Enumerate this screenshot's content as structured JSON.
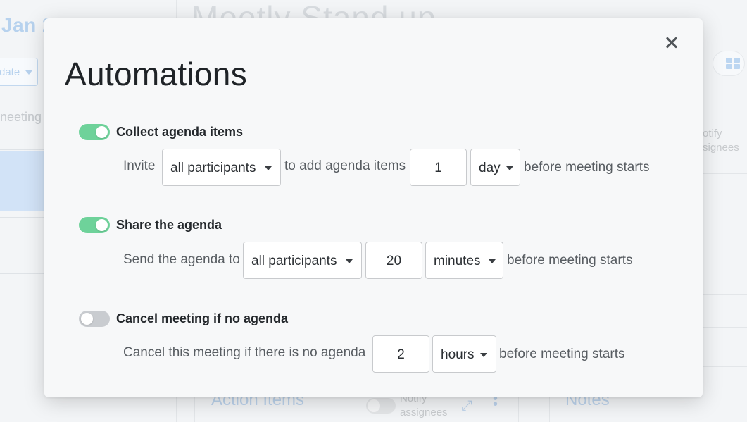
{
  "background": {
    "date_fragment": "Jan 2",
    "meeting_title": "Meetly Stand up",
    "update_button": "date",
    "meeting_fragment": "neeting",
    "notify_right": [
      "otify",
      "signees"
    ],
    "action_items_heading": "Action Items",
    "notify_assignees": [
      "Notify",
      "assignees"
    ],
    "notes_heading": "Notes"
  },
  "modal": {
    "title": "Automations",
    "sections": [
      {
        "label": "Collect agenda items",
        "enabled": true,
        "prefix": "Invite",
        "dropdown1": "all participants",
        "middle": "to add agenda items",
        "amount": "1",
        "unit": "day",
        "suffix": "before meeting starts"
      },
      {
        "label": "Share the agenda",
        "enabled": true,
        "prefix": "Send the agenda to",
        "dropdown1": "all participants",
        "amount": "20",
        "unit": "minutes",
        "suffix": "before meeting starts"
      },
      {
        "label": "Cancel meeting if no agenda",
        "enabled": false,
        "prefix": "Cancel this meeting if there is no agenda",
        "amount": "2",
        "unit": "hours",
        "suffix": "before meeting starts"
      }
    ]
  },
  "colors": {
    "toggle_on": "#6ed29a",
    "toggle_off": "#c9ccd0",
    "accent_blue": "#bcd3ec"
  },
  "icons": [
    "close-icon",
    "caret-down-icon",
    "grid-view-icon",
    "expand-icon",
    "more-vertical-icon"
  ]
}
